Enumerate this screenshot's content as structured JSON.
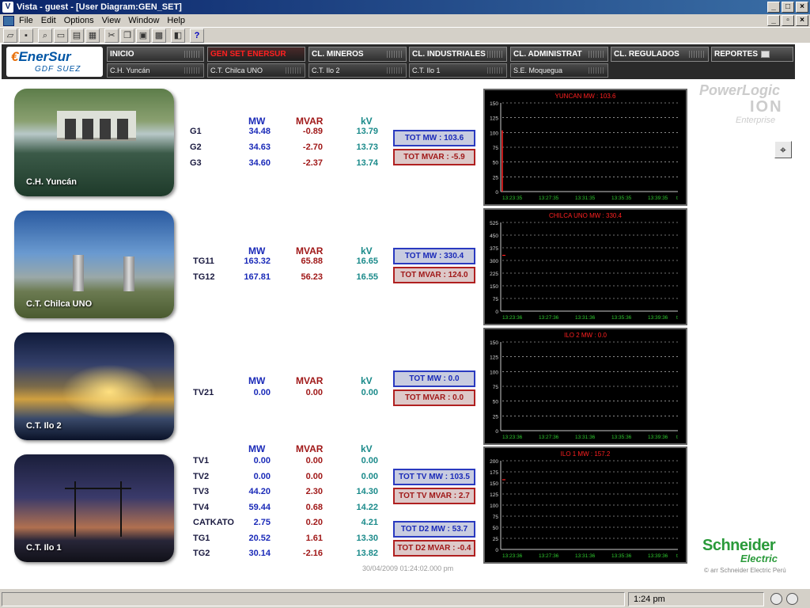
{
  "window": {
    "title": "Vista - guest - [User Diagram:GEN_SET]"
  },
  "menu": [
    "File",
    "Edit",
    "Options",
    "View",
    "Window",
    "Help"
  ],
  "toolbar_icons": [
    "open-icon",
    "save-icon",
    "zoom-icon",
    "window-icon",
    "dialog-icon",
    "chart-icon",
    "cut-icon",
    "copy-icon",
    "paste-icon",
    "grid-icon",
    "display-icon",
    "help-icon"
  ],
  "logo": {
    "name": "EnerSur",
    "sub": "GDF SUEZ"
  },
  "nav": [
    {
      "label": "INICIO",
      "active": false
    },
    {
      "label": "GEN SET ENERSUR",
      "active": true
    },
    {
      "label": "CL. MINEROS",
      "active": false
    },
    {
      "label": "CL. INDUSTRIALES",
      "active": false
    },
    {
      "label": "CL. ADMINISTRAT",
      "active": false
    },
    {
      "label": "CL. REGULADOS",
      "active": false
    },
    {
      "label": "REPORTES",
      "active": false
    }
  ],
  "subnav": [
    "C.H. Yuncán",
    "C.T. Chilca UNO",
    "C.T. Ilo 2",
    "C.T. Ilo 1",
    "S.E. Moquegua"
  ],
  "brand": {
    "powerlogic": "PowerLogic",
    "ion": "ION",
    "enterprise": "Enterprise",
    "schneider": "Schneider",
    "electric": "Electric",
    "copyright": "© arr Schneider Electric Perú"
  },
  "headers": {
    "mw": "MW",
    "mvar": "MVAR",
    "kv": "kV"
  },
  "plants": [
    {
      "caption": "C.H. Yuncán",
      "units": [
        {
          "name": "G1",
          "mw": "34.48",
          "mvar": "-0.89",
          "kv": "13.79"
        },
        {
          "name": "G2",
          "mw": "34.63",
          "mvar": "-2.70",
          "kv": "13.73"
        },
        {
          "name": "G3",
          "mw": "34.60",
          "mvar": "-2.37",
          "kv": "13.74"
        }
      ],
      "totals": [
        {
          "label": "TOT MW : 103.6",
          "kind": "mw"
        },
        {
          "label": "TOT MVAR : -5.9",
          "kind": "mvar"
        }
      ]
    },
    {
      "caption": "C.T. Chilca UNO",
      "units": [
        {
          "name": "TG11",
          "mw": "163.32",
          "mvar": "65.88",
          "kv": "16.65"
        },
        {
          "name": "TG12",
          "mw": "167.81",
          "mvar": "56.23",
          "kv": "16.55"
        }
      ],
      "totals": [
        {
          "label": "TOT MW : 330.4",
          "kind": "mw"
        },
        {
          "label": "TOT MVAR : 124.0",
          "kind": "mvar"
        }
      ]
    },
    {
      "caption": "C.T. Ilo 2",
      "units": [
        {
          "name": "TV21",
          "mw": "0.00",
          "mvar": "0.00",
          "kv": "0.00"
        }
      ],
      "totals": [
        {
          "label": "TOT MW : 0.0",
          "kind": "mw"
        },
        {
          "label": "TOT MVAR : 0.0",
          "kind": "mvar"
        }
      ]
    },
    {
      "caption": "C.T. Ilo 1",
      "units": [
        {
          "name": "TV1",
          "mw": "0.00",
          "mvar": "0.00",
          "kv": "0.00"
        },
        {
          "name": "TV2",
          "mw": "0.00",
          "mvar": "0.00",
          "kv": "0.00"
        },
        {
          "name": "TV3",
          "mw": "44.20",
          "mvar": "2.30",
          "kv": "14.30"
        },
        {
          "name": "TV4",
          "mw": "59.44",
          "mvar": "0.68",
          "kv": "14.22"
        },
        {
          "name": "CATKATO",
          "mw": "2.75",
          "mvar": "0.20",
          "kv": "4.21"
        },
        {
          "name": "TG1",
          "mw": "20.52",
          "mvar": "1.61",
          "kv": "13.30"
        },
        {
          "name": "TG2",
          "mw": "30.14",
          "mvar": "-2.16",
          "kv": "13.82"
        }
      ],
      "totals": [
        {
          "label": "TOT TV MW : 103.5",
          "kind": "mw"
        },
        {
          "label": "TOT TV MVAR : 2.7",
          "kind": "mvar"
        },
        {
          "label": "TOT D2 MW : 53.7",
          "kind": "mw"
        },
        {
          "label": "TOT D2 MVAR : -0.4",
          "kind": "mvar"
        }
      ]
    }
  ],
  "chart_data": [
    {
      "type": "line",
      "title": "YUNCAN MW : 103.6",
      "ylim": [
        0,
        150
      ],
      "yticks": [
        0,
        25,
        50,
        75,
        100,
        125,
        150
      ],
      "xticks": [
        "13:23:35",
        "13:27:35",
        "13:31:35",
        "13:35:35",
        "13:39:35",
        "t"
      ],
      "x": [
        "13:23:35",
        "13:23:35"
      ],
      "y": [
        0,
        103.6
      ],
      "grid": true,
      "color": "#ff2020"
    },
    {
      "type": "line",
      "title": "CHILCA UNO MW : 330.4",
      "ylim": [
        0,
        525
      ],
      "yticks": [
        0,
        75,
        150,
        225,
        300,
        375,
        450,
        525
      ],
      "xticks": [
        "13:23:36",
        "13:27:36",
        "13:31:36",
        "13:35:36",
        "13:39:36",
        "t"
      ],
      "x": [
        "13:23:36"
      ],
      "y": [
        330.4
      ],
      "grid": true,
      "color": "#ff2020"
    },
    {
      "type": "line",
      "title": "ILO 2 MW : 0.0",
      "ylim": [
        0,
        150
      ],
      "yticks": [
        0,
        25,
        50,
        75,
        100,
        125,
        150
      ],
      "xticks": [
        "13:23:36",
        "13:27:36",
        "13:31:36",
        "13:35:36",
        "13:39:36",
        "t"
      ],
      "x": [],
      "y": [],
      "grid": true,
      "color": "#ff2020"
    },
    {
      "type": "line",
      "title": "ILO 1 MW : 157.2",
      "ylim": [
        0,
        200
      ],
      "yticks": [
        0,
        25,
        50,
        75,
        100,
        125,
        150,
        175,
        200
      ],
      "xticks": [
        "13:23:36",
        "13:27:36",
        "13:31:36",
        "13:35:36",
        "13:39:36",
        "t"
      ],
      "x": [
        "13:23:36"
      ],
      "y": [
        157.2
      ],
      "grid": true,
      "color": "#ff2020"
    }
  ],
  "timestamp": "30/04/2009 01:24:02.000 pm",
  "status": {
    "time": "1:24 pm"
  }
}
